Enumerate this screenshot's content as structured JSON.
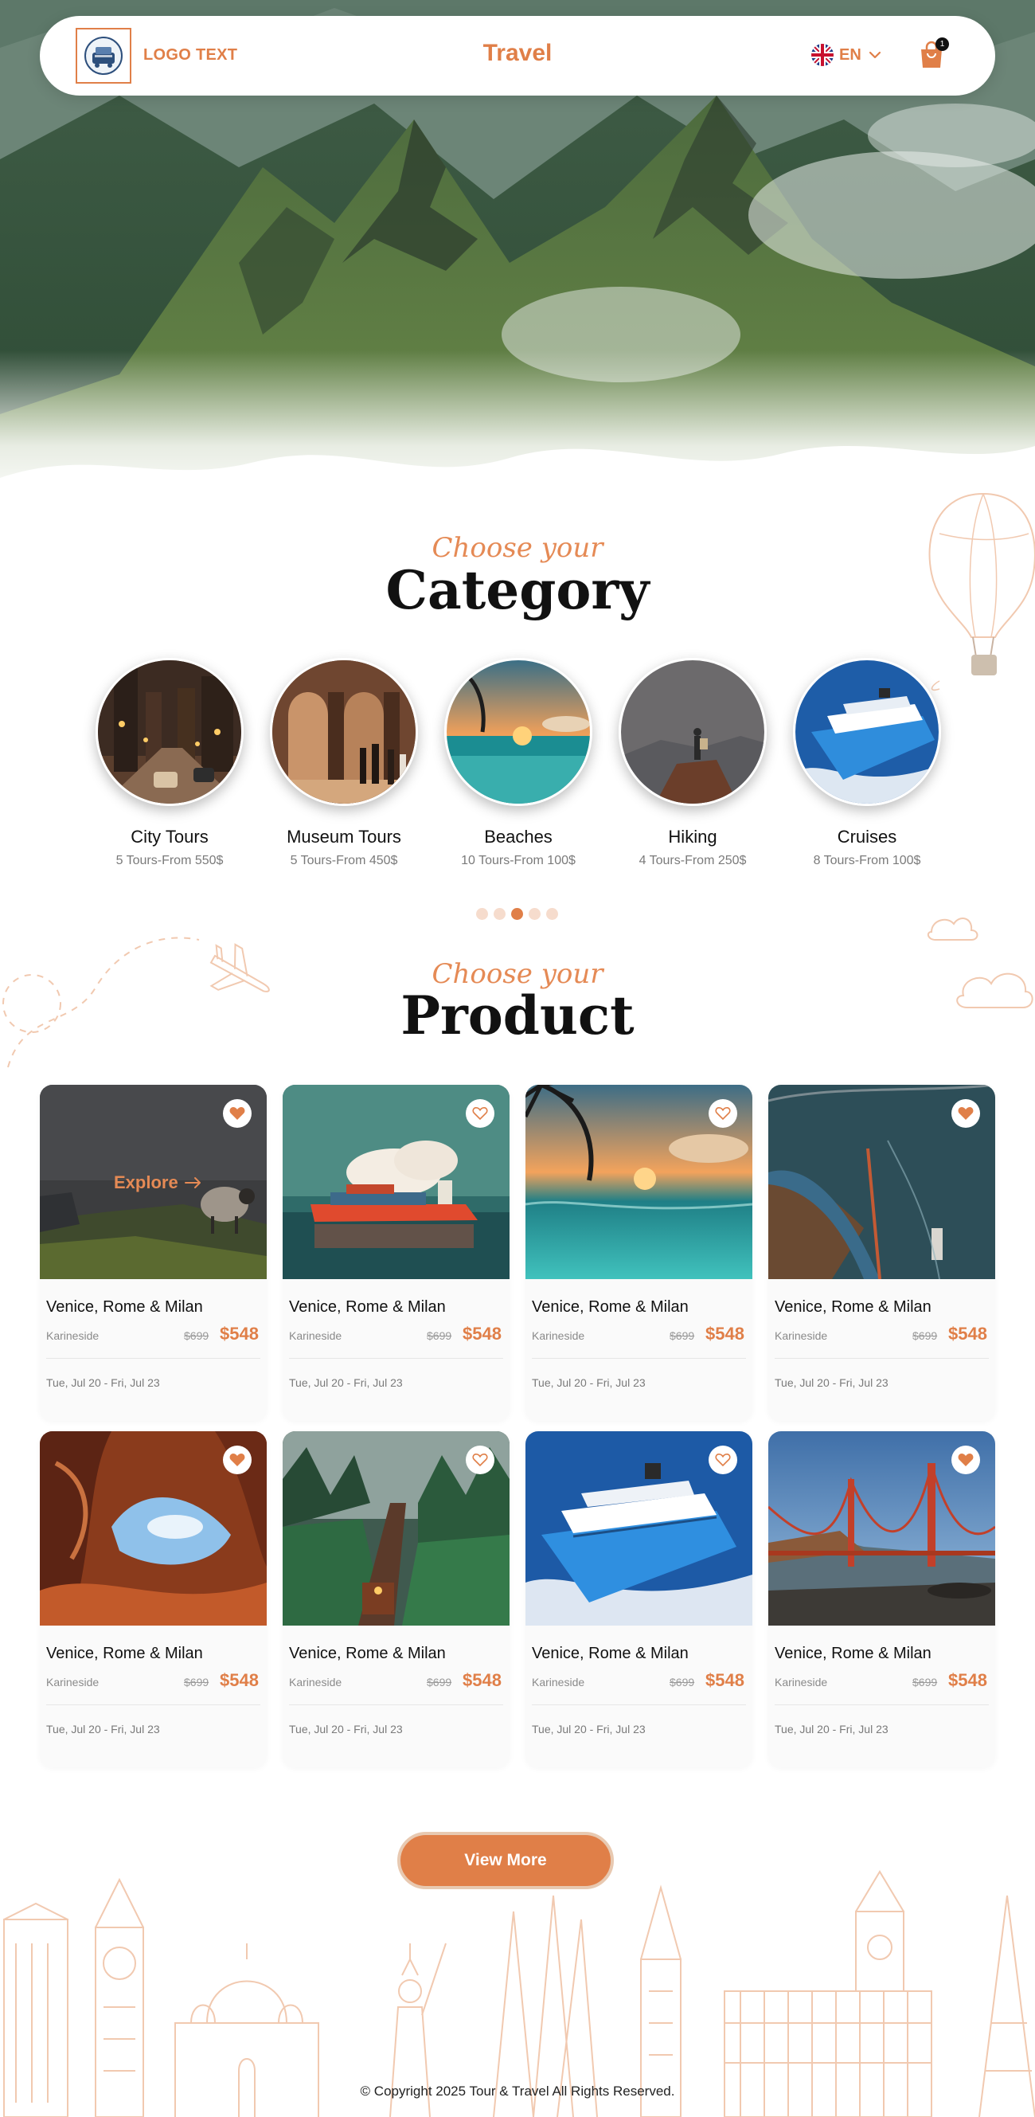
{
  "header": {
    "logo_text": "LOGO TEXT",
    "title": "Travel",
    "language": "EN",
    "cart_count": "1"
  },
  "category_section": {
    "eyebrow": "Choose your",
    "title": "Category",
    "items": [
      {
        "name": "City Tours",
        "sub": "5 Tours-From 550$"
      },
      {
        "name": "Museum Tours",
        "sub": "5 Tours-From 450$"
      },
      {
        "name": "Beaches",
        "sub": "10 Tours-From 100$"
      },
      {
        "name": "Hiking",
        "sub": "4 Tours-From 250$"
      },
      {
        "name": "Cruises",
        "sub": "8 Tours-From 100$"
      }
    ],
    "pagination_count": 5,
    "active_page": 3
  },
  "product_section": {
    "eyebrow": "Choose your",
    "title": "Product",
    "explore_label": "Explore",
    "products": [
      {
        "title": "Venice, Rome & Milan",
        "location": "Karineside",
        "old_price": "$699",
        "price": "$548",
        "dates": "Tue, Jul 20 - Fri, Jul 23",
        "favorited": true
      },
      {
        "title": "Venice, Rome & Milan",
        "location": "Karineside",
        "old_price": "$699",
        "price": "$548",
        "dates": "Tue, Jul 20 - Fri, Jul 23",
        "favorited": false
      },
      {
        "title": "Venice, Rome & Milan",
        "location": "Karineside",
        "old_price": "$699",
        "price": "$548",
        "dates": "Tue, Jul 20 - Fri, Jul 23",
        "favorited": false
      },
      {
        "title": "Venice, Rome & Milan",
        "location": "Karineside",
        "old_price": "$699",
        "price": "$548",
        "dates": "Tue, Jul 20 - Fri, Jul 23",
        "favorited": true
      },
      {
        "title": "Venice, Rome & Milan",
        "location": "Karineside",
        "old_price": "$699",
        "price": "$548",
        "dates": "Tue, Jul 20 - Fri, Jul 23",
        "favorited": true
      },
      {
        "title": "Venice, Rome & Milan",
        "location": "Karineside",
        "old_price": "$699",
        "price": "$548",
        "dates": "Tue, Jul 20 - Fri, Jul 23",
        "favorited": false
      },
      {
        "title": "Venice, Rome & Milan",
        "location": "Karineside",
        "old_price": "$699",
        "price": "$548",
        "dates": "Tue, Jul 20 - Fri, Jul 23",
        "favorited": false
      },
      {
        "title": "Venice, Rome & Milan",
        "location": "Karineside",
        "old_price": "$699",
        "price": "$548",
        "dates": "Tue, Jul 20 - Fri, Jul 23",
        "favorited": true
      }
    ],
    "view_more_label": "View More"
  },
  "footer": {
    "copyright": "© Copyright 2025 Tour & Travel All Rights Reserved."
  },
  "colors": {
    "accent": "#e07f48",
    "accent_light": "#f6dccd",
    "line_art": "#f1c9b0"
  }
}
